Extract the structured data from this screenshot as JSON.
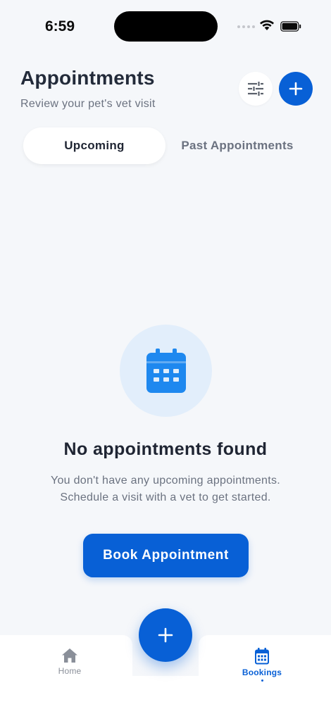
{
  "status_bar": {
    "time": "6:59"
  },
  "header": {
    "title": "Appointments",
    "subtitle": "Review your pet's vet visit",
    "filter_icon": "sliders-icon",
    "add_icon": "plus-icon"
  },
  "tabs": [
    {
      "label": "Upcoming",
      "active": true
    },
    {
      "label": "Past Appointments",
      "active": false
    }
  ],
  "empty_state": {
    "icon": "calendar-icon",
    "title": "No appointments found",
    "line1": "You don't have any upcoming appointments.",
    "line2": "Schedule a visit with a vet to get started.",
    "button_label": "Book Appointment"
  },
  "bottom_nav": {
    "items": [
      {
        "label": "Home",
        "icon": "home-icon",
        "active": false
      },
      {
        "label": "Bookings",
        "icon": "calendar-icon",
        "active": true
      }
    ],
    "fab_icon": "plus-icon"
  },
  "colors": {
    "accent": "#0860d6",
    "background": "#f5f7fa",
    "empty_circle": "#e2eefb",
    "text_primary": "#1f2533",
    "text_secondary": "#6b7280"
  }
}
